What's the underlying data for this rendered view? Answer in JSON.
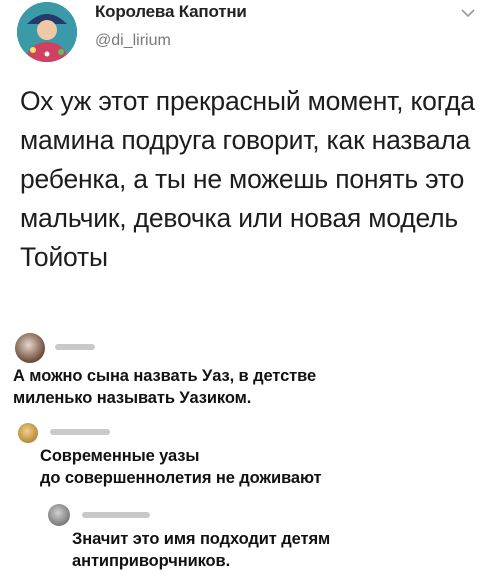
{
  "tweet": {
    "display_name": "Королева Капотни",
    "handle": "@di_lirium",
    "text": "Ох уж этот прекрасный момент, когда мамина подруга говорит, как назвала ребенка, а ты не можешь понять это мальчик, девочка или новая модель Тойоты"
  },
  "comments": [
    {
      "text_line1": "А можно сына назвать Уаз, в детстве",
      "text_line2": "миленько называть Уазиком."
    },
    {
      "text_line1": "Современные уазы",
      "text_line2": "до совершеннолетия не доживают"
    },
    {
      "text_line1": "Значит это имя подходит детям",
      "text_line2": "антиприворчников."
    }
  ]
}
